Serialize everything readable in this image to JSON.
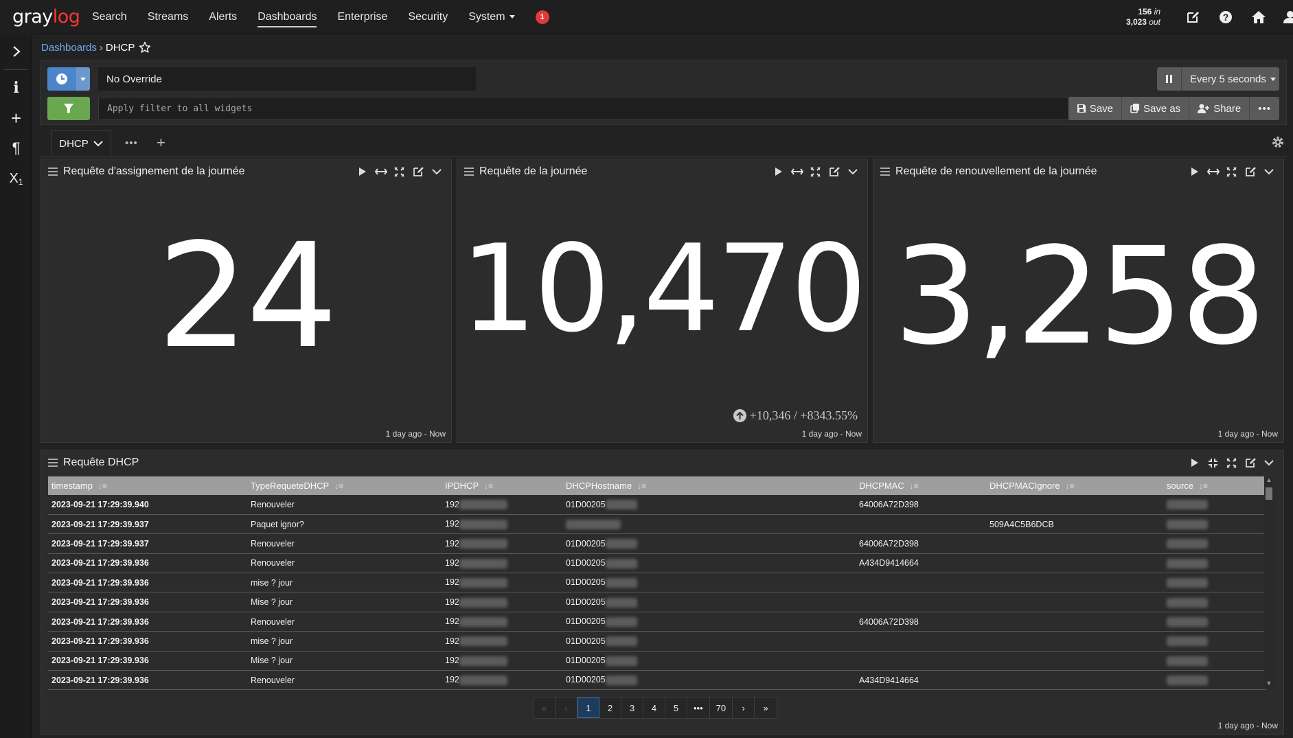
{
  "app": {
    "logo_pre": "gray",
    "logo_post": "log"
  },
  "nav": {
    "items": [
      "Search",
      "Streams",
      "Alerts",
      "Dashboards",
      "Enterprise",
      "Security",
      "System"
    ],
    "active": "Dashboards",
    "notifications": "1"
  },
  "throughput": {
    "in_value": "156",
    "in_label": "in",
    "out_value": "3,023",
    "out_label": "out"
  },
  "breadcrumb": {
    "parent": "Dashboards",
    "separator": "›",
    "current": "DHCP"
  },
  "query": {
    "time_range": "No Override",
    "refresh_label": "Every 5 seconds",
    "filter_placeholder": "Apply filter to all widgets",
    "save_label": "Save",
    "save_as_label": "Save as",
    "share_label": "Share"
  },
  "tabs": {
    "active_label": "DHCP"
  },
  "widgets": [
    {
      "title": "Requête d'assignement de la journée",
      "value": "24",
      "timeframe": "1 day ago - Now"
    },
    {
      "title": "Requête de la journée",
      "value": "10,470",
      "trend": "+10,346 / +8343.55%",
      "timeframe": "1 day ago - Now"
    },
    {
      "title": "Requête de renouvellement de la journée",
      "value": "3,258",
      "timeframe": "1 day ago - Now"
    }
  ],
  "table_widget": {
    "title": "Requête DHCP",
    "timeframe": "1 day ago - Now",
    "columns": [
      "timestamp",
      "TypeRequeteDHCP",
      "IPDHCP",
      "DHCPHostname",
      "DHCPMAC",
      "DHCPMACIgnore",
      "source"
    ],
    "rows": [
      {
        "timestamp": "2023-09-21 17:29:39.940",
        "type": "Renouveler",
        "ip": "192",
        "host": "01D00205",
        "mac": "64006A72D398",
        "ignore": ""
      },
      {
        "timestamp": "2023-09-21 17:29:39.937",
        "type": "Paquet ignor?",
        "ip": "192",
        "host": "",
        "mac": "",
        "ignore": "509A4C5B6DCB"
      },
      {
        "timestamp": "2023-09-21 17:29:39.937",
        "type": "Renouveler",
        "ip": "192",
        "host": "01D00205",
        "mac": "64006A72D398",
        "ignore": ""
      },
      {
        "timestamp": "2023-09-21 17:29:39.936",
        "type": "Renouveler",
        "ip": "192",
        "host": "01D00205",
        "mac": "A434D9414664",
        "ignore": ""
      },
      {
        "timestamp": "2023-09-21 17:29:39.936",
        "type": "mise ? jour",
        "ip": "192",
        "host": "01D00205",
        "mac": "",
        "ignore": ""
      },
      {
        "timestamp": "2023-09-21 17:29:39.936",
        "type": "Mise ? jour",
        "ip": "192",
        "host": "01D00205",
        "mac": "",
        "ignore": ""
      },
      {
        "timestamp": "2023-09-21 17:29:39.936",
        "type": "Renouveler",
        "ip": "192",
        "host": "01D00205",
        "mac": "64006A72D398",
        "ignore": ""
      },
      {
        "timestamp": "2023-09-21 17:29:39.936",
        "type": "mise ? jour",
        "ip": "192",
        "host": "01D00205",
        "mac": "",
        "ignore": ""
      },
      {
        "timestamp": "2023-09-21 17:29:39.936",
        "type": "Mise ? jour",
        "ip": "192",
        "host": "01D00205",
        "mac": "",
        "ignore": ""
      },
      {
        "timestamp": "2023-09-21 17:29:39.936",
        "type": "Renouveler",
        "ip": "192",
        "host": "01D00205",
        "mac": "A434D9414664",
        "ignore": ""
      }
    ]
  },
  "pagination": {
    "pages": [
      "1",
      "2",
      "3",
      "4",
      "5",
      "•••",
      "70"
    ],
    "current": "1"
  },
  "colors": {
    "accent_blue": "#4a86c9",
    "filter_green": "#6aa84f",
    "badge_red": "#e03a3a",
    "logo_red": "#ff3633",
    "link": "#6fa8ee"
  },
  "icons": [
    "clock-icon",
    "filter-icon",
    "pause-icon",
    "lightbulb-icon",
    "save-icon",
    "copy-icon",
    "share-icon",
    "gear-icon",
    "play-icon",
    "expand-horizontal-icon",
    "fullscreen-icon",
    "edit-icon",
    "chevron-down-icon",
    "star-icon",
    "home-icon",
    "help-icon",
    "user-icon"
  ]
}
